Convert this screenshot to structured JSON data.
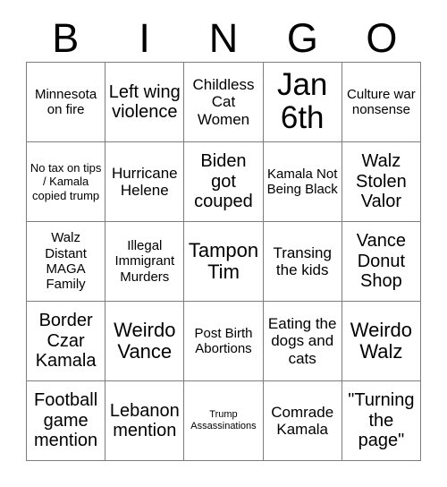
{
  "card": {
    "title": "BINGO",
    "header_letters": [
      "B",
      "I",
      "N",
      "G",
      "O"
    ],
    "columns": 5,
    "rows": 5,
    "border_color": "#7d7d7d",
    "background_color": "#ffffff",
    "text_color": "#000000"
  },
  "cells": [
    {
      "text": "Minnesota on fire",
      "size": "m",
      "row": 1,
      "col": "B"
    },
    {
      "text": "Left wing violence",
      "size": "xl",
      "row": 1,
      "col": "I"
    },
    {
      "text": "Childless Cat Women",
      "size": "l",
      "row": 1,
      "col": "N"
    },
    {
      "text": "Jan 6th",
      "size": "huge",
      "row": 1,
      "col": "G"
    },
    {
      "text": "Culture war nonsense",
      "size": "m",
      "row": 1,
      "col": "O"
    },
    {
      "text": "No tax on tips / Kamala copied trump",
      "size": "s",
      "row": 2,
      "col": "B"
    },
    {
      "text": "Hurricane Helene",
      "size": "l",
      "row": 2,
      "col": "I"
    },
    {
      "text": "Biden got couped",
      "size": "xl",
      "row": 2,
      "col": "N"
    },
    {
      "text": "Kamala Not Being Black",
      "size": "m",
      "row": 2,
      "col": "G"
    },
    {
      "text": "Walz Stolen Valor",
      "size": "xl",
      "row": 2,
      "col": "O"
    },
    {
      "text": "Walz Distant MAGA Family",
      "size": "m",
      "row": 3,
      "col": "B"
    },
    {
      "text": "Illegal Immigrant Murders",
      "size": "m",
      "row": 3,
      "col": "I"
    },
    {
      "text": "Tampon Tim",
      "size": "xxl",
      "row": 3,
      "col": "N"
    },
    {
      "text": "Transing the kids",
      "size": "l",
      "row": 3,
      "col": "G"
    },
    {
      "text": "Vance Donut Shop",
      "size": "xl",
      "row": 3,
      "col": "O"
    },
    {
      "text": "Border Czar Kamala",
      "size": "xl",
      "row": 4,
      "col": "B"
    },
    {
      "text": "Weirdo Vance",
      "size": "xxl",
      "row": 4,
      "col": "I"
    },
    {
      "text": "Post Birth Abortions",
      "size": "m",
      "row": 4,
      "col": "N"
    },
    {
      "text": "Eating the dogs and cats",
      "size": "l",
      "row": 4,
      "col": "G"
    },
    {
      "text": "Weirdo Walz",
      "size": "xxl",
      "row": 4,
      "col": "O"
    },
    {
      "text": "Football game mention",
      "size": "xl",
      "row": 5,
      "col": "B"
    },
    {
      "text": "Lebanon mention",
      "size": "xl",
      "row": 5,
      "col": "I"
    },
    {
      "text": "Trump Assassinations",
      "size": "xs",
      "row": 5,
      "col": "N"
    },
    {
      "text": "Comrade Kamala",
      "size": "l",
      "row": 5,
      "col": "G"
    },
    {
      "text": "\"Turning the page\"",
      "size": "xl",
      "row": 5,
      "col": "O"
    }
  ]
}
